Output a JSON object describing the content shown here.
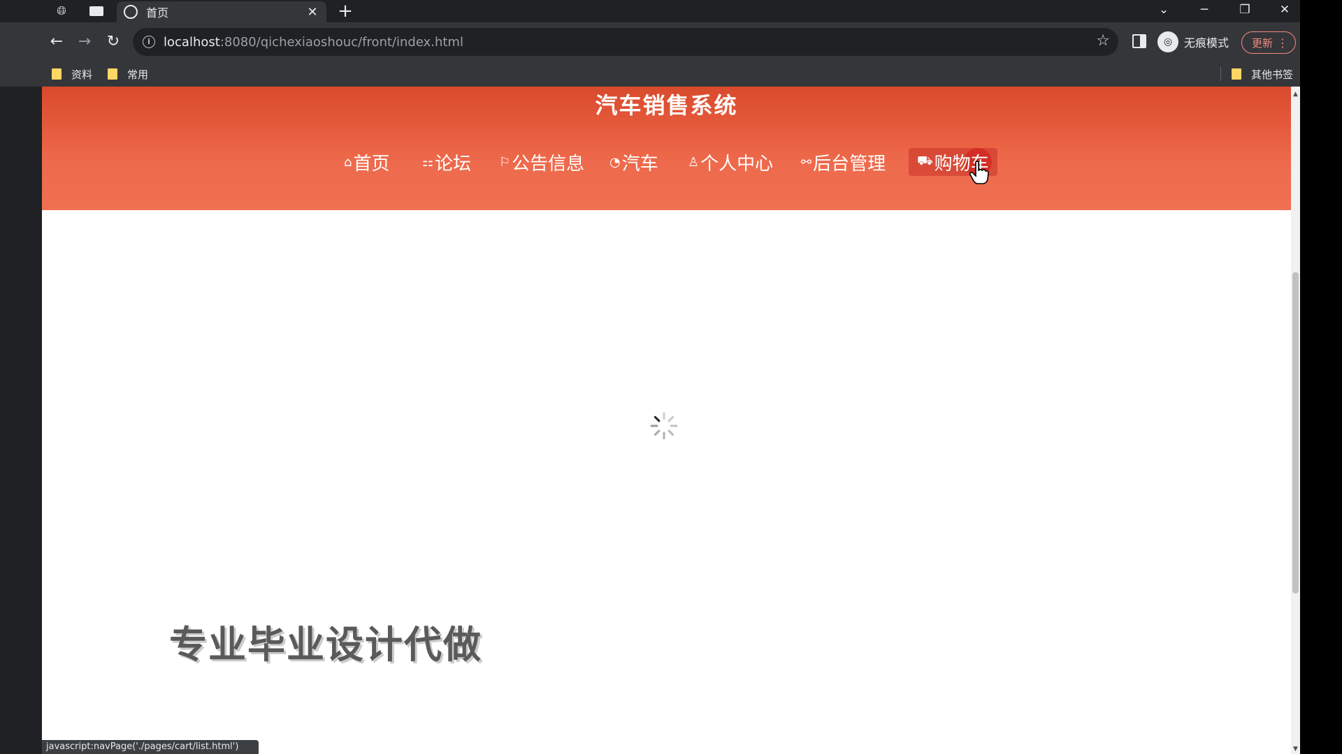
{
  "browser": {
    "tab": {
      "title": "首页",
      "close": "✕"
    },
    "new_tab": "+",
    "window_controls": {
      "tablist": "⌄",
      "minimize": "─",
      "restore": "❐",
      "close": "✕"
    },
    "nav": {
      "back": "←",
      "forward": "→",
      "reload": "↻"
    },
    "address": {
      "host": "localhost",
      "rest": ":8080/qichexiaoshouc/front/index.html"
    },
    "incognito_label": "无痕模式",
    "update_label": "更新",
    "bookmarks": [
      {
        "label": "资料"
      },
      {
        "label": "常用"
      }
    ],
    "other_bookmarks": "其他书签",
    "status_url": "javascript:navPage('./pages/cart/list.html')"
  },
  "site": {
    "title": "汽车销售系统",
    "menu": [
      {
        "label": "首页",
        "icon": "home-icon",
        "glyph": "⌂"
      },
      {
        "label": "论坛",
        "icon": "forum-icon",
        "glyph": "⚏"
      },
      {
        "label": "公告信息",
        "icon": "flag-icon",
        "glyph": "⚐"
      },
      {
        "label": "汽车",
        "icon": "power-icon",
        "glyph": "◔"
      },
      {
        "label": "个人中心",
        "icon": "user-icon",
        "glyph": "♙"
      },
      {
        "label": "后台管理",
        "icon": "link-icon",
        "glyph": "⚯"
      },
      {
        "label": "购物车",
        "icon": "cart-icon",
        "glyph": "⛟"
      }
    ],
    "promo_text": "专业毕业设计代做"
  },
  "colors": {
    "header_top": "#d84a2c",
    "header_bottom": "#f07052",
    "hover_bg": "#c83228"
  }
}
